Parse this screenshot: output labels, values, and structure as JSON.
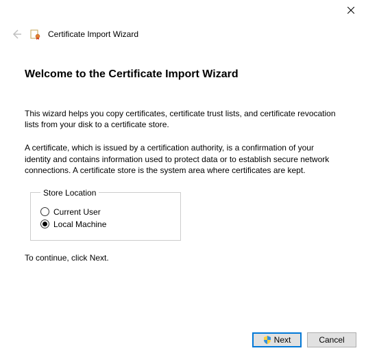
{
  "window": {
    "title": "Certificate Import Wizard"
  },
  "page": {
    "welcome_title": "Welcome to the Certificate Import Wizard",
    "intro": "This wizard helps you copy certificates, certificate trust lists, and certificate revocation lists from your disk to a certificate store.",
    "explanation": "A certificate, which is issued by a certification authority, is a confirmation of your identity and contains information used to protect data or to establish secure network connections. A certificate store is the system area where certificates are kept.",
    "continue_hint": "To continue, click Next."
  },
  "store_location": {
    "legend": "Store Location",
    "options": {
      "current_user": "Current User",
      "local_machine": "Local Machine"
    },
    "selected": "local_machine"
  },
  "buttons": {
    "next": "Next",
    "cancel": "Cancel"
  }
}
